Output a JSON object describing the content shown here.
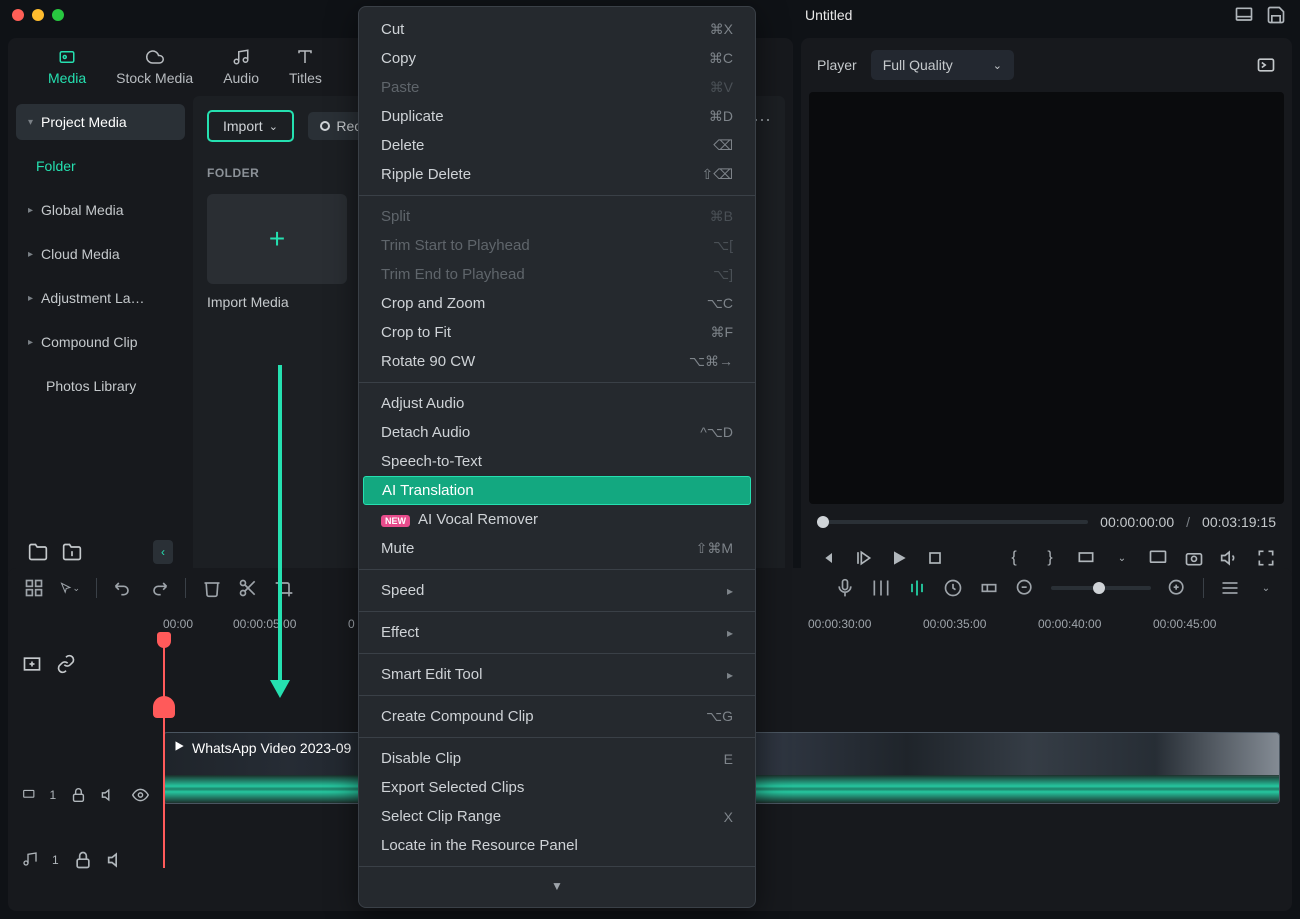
{
  "title": "Untitled",
  "tabs": {
    "media": "Media",
    "stock": "Stock Media",
    "audio": "Audio",
    "titles": "Titles"
  },
  "sidebar": {
    "project": "Project Media",
    "folder": "Folder",
    "global": "Global Media",
    "cloud": "Cloud Media",
    "adjust": "Adjustment La…",
    "compound": "Compound Clip",
    "photos": "Photos Library"
  },
  "mediapanel": {
    "import": "Import",
    "record": "Rec",
    "folderLabel": "FOLDER",
    "importMedia": "Import Media"
  },
  "player": {
    "label": "Player",
    "quality": "Full Quality",
    "current": "00:00:00:00",
    "total": "00:03:19:15"
  },
  "ctx": {
    "cut": "Cut",
    "cutSc": "⌘X",
    "copy": "Copy",
    "copySc": "⌘C",
    "paste": "Paste",
    "pasteSc": "⌘V",
    "dup": "Duplicate",
    "dupSc": "⌘D",
    "del": "Delete",
    "delSc": "⌫",
    "ripple": "Ripple Delete",
    "rippleSc": "⇧⌫",
    "split": "Split",
    "splitSc": "⌘B",
    "trimStart": "Trim Start to Playhead",
    "trimStartSc": "⌥[",
    "trimEnd": "Trim End to Playhead",
    "trimEndSc": "⌥]",
    "crop": "Crop and Zoom",
    "cropSc": "⌥C",
    "fit": "Crop to Fit",
    "fitSc": "⌘F",
    "rotate": "Rotate 90 CW",
    "rotateSc": "⌥⌘→",
    "adjAudio": "Adjust Audio",
    "detach": "Detach Audio",
    "detachSc": "^⌥D",
    "stt": "Speech-to-Text",
    "aiTrans": "AI Translation",
    "aiVocal": "AI Vocal Remover",
    "newBadge": "NEW",
    "mute": "Mute",
    "muteSc": "⇧⌘M",
    "speed": "Speed",
    "effect": "Effect",
    "smart": "Smart Edit Tool",
    "compound": "Create Compound Clip",
    "compoundSc": "⌥G",
    "disable": "Disable Clip",
    "disableSc": "E",
    "export": "Export Selected Clips",
    "selrange": "Select Clip Range",
    "selrangeSc": "X",
    "locate": "Locate in the Resource Panel"
  },
  "ruler": {
    "t0": "00:00",
    "t5": "00:00:05:00",
    "t10": "0",
    "t30": "00:00:30:00",
    "t35": "00:00:35:00",
    "t40": "00:00:40:00",
    "t45": "00:00:45:00"
  },
  "clip": {
    "name": "WhatsApp Video 2023-09"
  },
  "track": {
    "v1": "1",
    "a1": "1"
  }
}
